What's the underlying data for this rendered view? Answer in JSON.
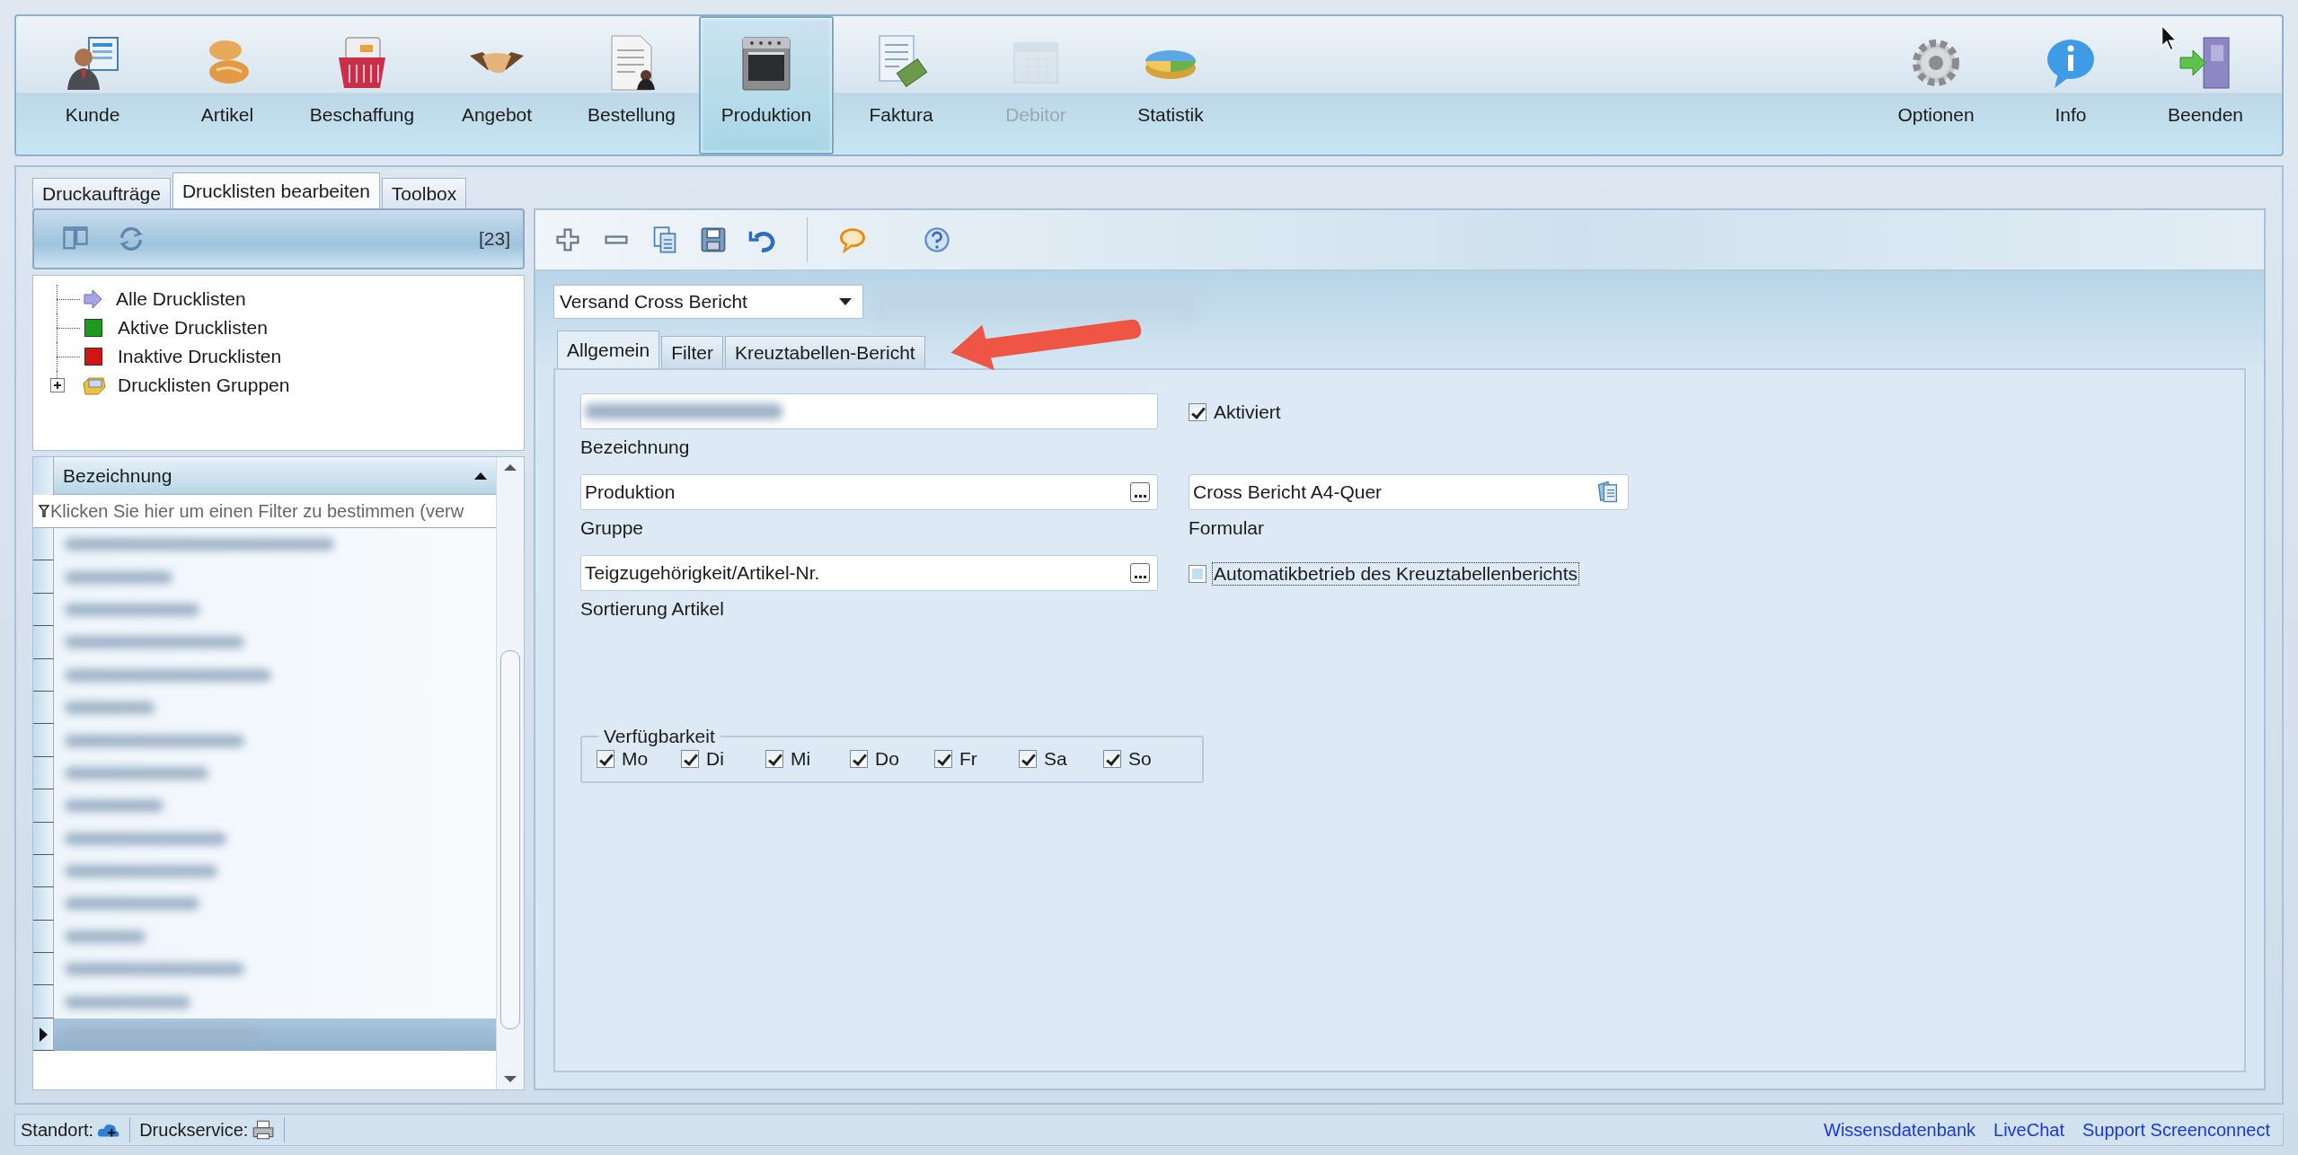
{
  "ribbon": {
    "left": [
      {
        "label": "Kunde",
        "kind": "customer",
        "selected": false,
        "disabled": false
      },
      {
        "label": "Artikel",
        "kind": "bread",
        "selected": false,
        "disabled": false
      },
      {
        "label": "Beschaffung",
        "kind": "basket",
        "selected": false,
        "disabled": false
      },
      {
        "label": "Angebot",
        "kind": "handshake",
        "selected": false,
        "disabled": false
      },
      {
        "label": "Bestellung",
        "kind": "document",
        "selected": false,
        "disabled": false
      },
      {
        "label": "Produktion",
        "kind": "oven",
        "selected": true,
        "disabled": false
      },
      {
        "label": "Faktura",
        "kind": "invoice",
        "selected": false,
        "disabled": false
      },
      {
        "label": "Debitor",
        "kind": "calendar",
        "selected": false,
        "disabled": true
      },
      {
        "label": "Statistik",
        "kind": "pie",
        "selected": false,
        "disabled": false
      }
    ],
    "right": [
      {
        "label": "Optionen",
        "kind": "gear",
        "selected": false,
        "disabled": false
      },
      {
        "label": "Info",
        "kind": "info",
        "selected": false,
        "disabled": false
      },
      {
        "label": "Beenden",
        "kind": "exit",
        "selected": false,
        "disabled": false
      }
    ]
  },
  "main_tabs": [
    {
      "label": "Druckaufträge",
      "selected": false
    },
    {
      "label": "Drucklisten bearbeiten",
      "selected": true
    },
    {
      "label": "Toolbox",
      "selected": false
    }
  ],
  "list_panel": {
    "count": "[23]",
    "tree": [
      {
        "label": "Alle Drucklisten",
        "kind": "arrow"
      },
      {
        "label": "Aktive Drucklisten",
        "kind": "square",
        "color": "#1e9a1e"
      },
      {
        "label": "Inaktive Drucklisten",
        "kind": "square",
        "color": "#d21414"
      },
      {
        "label": "Drucklisten Gruppen",
        "kind": "folder",
        "expanded": false
      }
    ],
    "grid": {
      "column": "Bezeichnung",
      "filter_hint": "Klicken Sie hier um einen Filter zu bestimmen (verw",
      "rows": [
        {
          "selected": false
        },
        {
          "selected": false
        },
        {
          "selected": false
        },
        {
          "selected": false
        },
        {
          "selected": false
        },
        {
          "selected": false
        },
        {
          "selected": false
        },
        {
          "selected": false
        },
        {
          "selected": false
        },
        {
          "selected": false
        },
        {
          "selected": false
        },
        {
          "selected": false
        },
        {
          "selected": false
        },
        {
          "selected": false
        },
        {
          "selected": false
        },
        {
          "selected": true
        }
      ]
    }
  },
  "report_select": {
    "value": "Versand Cross Bericht"
  },
  "detail_tabs": [
    {
      "label": "Allgemein",
      "selected": true
    },
    {
      "label": "Filter",
      "selected": false
    },
    {
      "label": "Kreuztabellen-Bericht",
      "selected": false
    }
  ],
  "form": {
    "name_label": "Bezeichnung",
    "active": {
      "label": "Aktiviert",
      "checked": true
    },
    "group": {
      "value": "Produktion",
      "label": "Gruppe"
    },
    "layout": {
      "value": "Cross Bericht A4-Quer",
      "label": "Formular"
    },
    "sorting": {
      "value": "Teigzugehörigkeit/Artikel-Nr.",
      "label": "Sortierung Artikel"
    },
    "auto": {
      "label": "Automatikbetrieb des Kreuztabellenberichts",
      "checked": false,
      "focused": true
    }
  },
  "availability": {
    "title": "Verfügbarkeit",
    "days": [
      {
        "label": "Mo",
        "checked": true
      },
      {
        "label": "Di",
        "checked": true
      },
      {
        "label": "Mi",
        "checked": true
      },
      {
        "label": "Do",
        "checked": true
      },
      {
        "label": "Fr",
        "checked": true
      },
      {
        "label": "Sa",
        "checked": true
      },
      {
        "label": "So",
        "checked": true
      }
    ]
  },
  "status_bar": {
    "location_label": "Standort:",
    "print_service_label": "Druckservice:",
    "links": [
      "Wissensdatenbank",
      "LiveChat",
      "Support Screenconnect"
    ]
  }
}
